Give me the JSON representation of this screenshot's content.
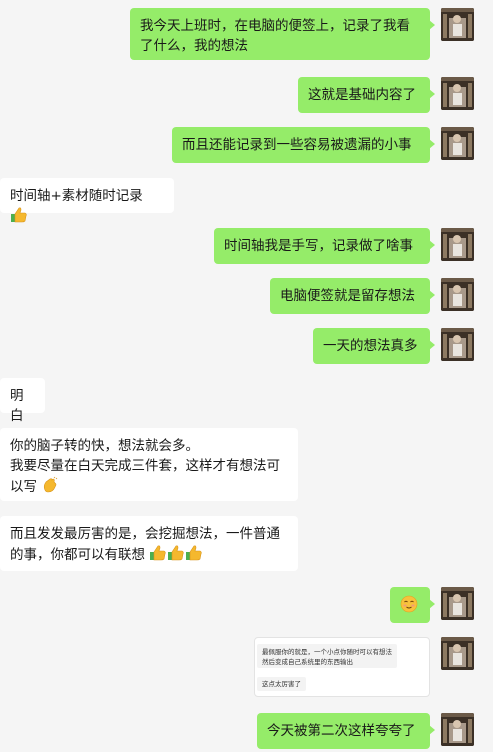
{
  "messages": [
    {
      "side": "sent",
      "text": "我今天上班时，在电脑的便签上，记录了我看了什么，我的想法"
    },
    {
      "side": "sent",
      "text": "这就是基础内容了"
    },
    {
      "side": "sent",
      "text": "而且还能记录到一些容易被遗漏的小事"
    },
    {
      "side": "recv",
      "text": "时间轴+素材随时记录",
      "emoji": "thumbs-up-icon"
    },
    {
      "side": "sent",
      "text": "时间轴我是手写，记录做了啥事"
    },
    {
      "side": "sent",
      "text": "电脑便签就是留存想法"
    },
    {
      "side": "sent",
      "text": "一天的想法真多"
    },
    {
      "side": "recv",
      "text": "明白"
    },
    {
      "side": "recv",
      "text_line1": "你的脑子转的快，想法就会多。",
      "text_line2": "我要尽量在白天完成三件套，这样才有想法可以写",
      "emoji": "clap-icon"
    },
    {
      "side": "recv",
      "text": "而且发发最厉害的是，会挖掘想法，一件普通的事，你都可以有联想",
      "emoji": "thumbs-up-icon x3"
    },
    {
      "side": "sent",
      "emoji": "smiling-face-icon"
    },
    {
      "side": "sent",
      "quote_line1": "最佩服你的就是，一个小点你随时可以有想法",
      "quote_line2": "然后变成自己系统里的东西输出",
      "quote_reply": "这点太厉害了"
    },
    {
      "side": "sent",
      "text": "今天被第二次这样夸夸了"
    }
  ],
  "colors": {
    "background": "#f5f5f5",
    "sent_bubble": "#95ec69",
    "recv_bubble": "#ffffff"
  }
}
